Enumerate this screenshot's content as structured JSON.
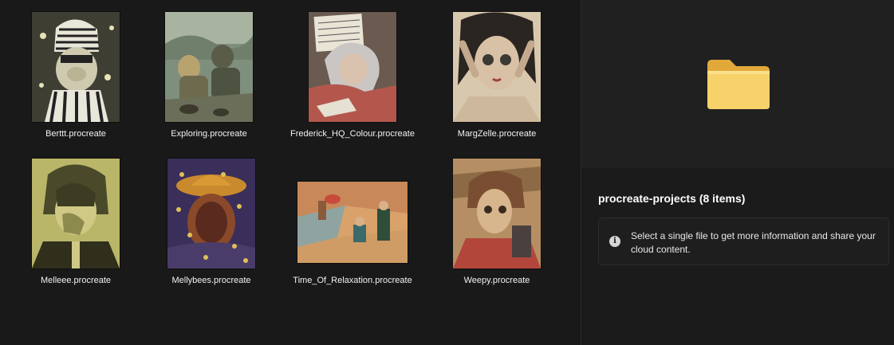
{
  "files": [
    {
      "name": "Berttt.procreate",
      "icon": "procreate-artwork-thumbnail"
    },
    {
      "name": "Exploring.procreate",
      "icon": "procreate-artwork-thumbnail"
    },
    {
      "name": "Frederick_HQ_Colour.procreate",
      "icon": "procreate-artwork-thumbnail"
    },
    {
      "name": "MargZelle.procreate",
      "icon": "procreate-artwork-thumbnail"
    },
    {
      "name": "Melleee.procreate",
      "icon": "procreate-artwork-thumbnail"
    },
    {
      "name": "Mellybees.procreate",
      "icon": "procreate-artwork-thumbnail"
    },
    {
      "name": "Time_Of_Relaxation.procreate",
      "icon": "procreate-artwork-thumbnail"
    },
    {
      "name": "Weepy.procreate",
      "icon": "procreate-artwork-thumbnail"
    }
  ],
  "details": {
    "title": "procreate-projects (8 items)",
    "info_text": "Select a single file to get more information and share your cloud content.",
    "folder_icon": "folder-icon",
    "info_icon": "info-icon",
    "folder_color": "#f5c84c"
  }
}
